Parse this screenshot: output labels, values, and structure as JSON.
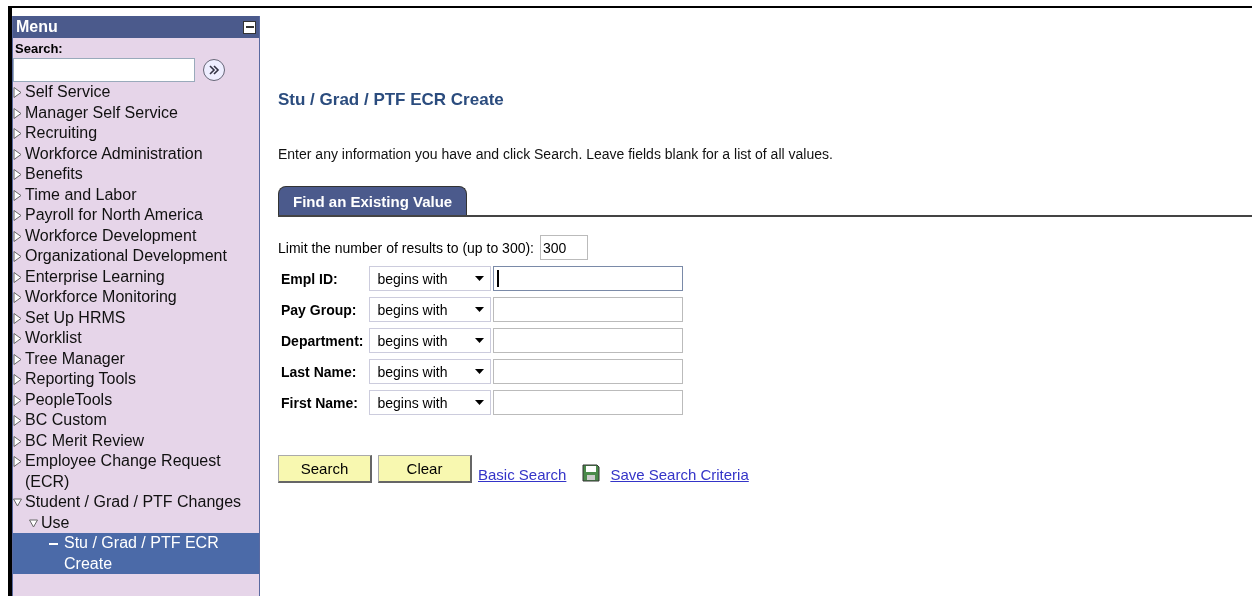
{
  "menu": {
    "title": "Menu",
    "search_label": "Search:",
    "items": [
      {
        "label": "Self Service",
        "expanded": false,
        "selected": false
      },
      {
        "label": "Manager Self Service",
        "expanded": false,
        "selected": false
      },
      {
        "label": "Recruiting",
        "expanded": false,
        "selected": false
      },
      {
        "label": "Workforce Administration",
        "expanded": false,
        "selected": false
      },
      {
        "label": "Benefits",
        "expanded": false,
        "selected": false
      },
      {
        "label": "Time and Labor",
        "expanded": false,
        "selected": false
      },
      {
        "label": "Payroll for North America",
        "expanded": false,
        "selected": false
      },
      {
        "label": "Workforce Development",
        "expanded": false,
        "selected": false
      },
      {
        "label": "Organizational Development",
        "expanded": false,
        "selected": false
      },
      {
        "label": "Enterprise Learning",
        "expanded": false,
        "selected": false
      },
      {
        "label": "Workforce Monitoring",
        "expanded": false,
        "selected": false
      },
      {
        "label": "Set Up HRMS",
        "expanded": false,
        "selected": false
      },
      {
        "label": "Worklist",
        "expanded": false,
        "selected": false
      },
      {
        "label": "Tree Manager",
        "expanded": false,
        "selected": false
      },
      {
        "label": "Reporting Tools",
        "expanded": false,
        "selected": false
      },
      {
        "label": "PeopleTools",
        "expanded": false,
        "selected": false
      },
      {
        "label": "BC Custom",
        "expanded": false,
        "selected": false
      },
      {
        "label": "BC Merit Review",
        "expanded": false,
        "selected": false
      },
      {
        "label": "Employee Change Request (ECR)",
        "expanded": false,
        "selected": false
      },
      {
        "label": "Student / Grad / PTF Changes",
        "expanded": true,
        "selected": false,
        "children": [
          {
            "label": "Use",
            "expanded": true,
            "selected": false,
            "children": [
              {
                "label": "Stu / Grad / PTF ECR Create",
                "kind": "page",
                "selected": true
              }
            ]
          }
        ]
      }
    ]
  },
  "page": {
    "title": "Stu / Grad / PTF ECR Create",
    "instructions": "Enter any information you have and click Search. Leave fields blank for a list of all values.",
    "tabs": [
      {
        "label": "Find an Existing Value",
        "selected": true
      }
    ],
    "limit": {
      "label": "Limit the number of results to (up to 300):",
      "value": "300"
    },
    "fields": [
      {
        "label": "Empl ID:",
        "operator": "begins with",
        "focused": true
      },
      {
        "label": "Pay Group:",
        "operator": "begins with",
        "focused": false
      },
      {
        "label": "Department:",
        "operator": "begins with",
        "focused": false
      },
      {
        "label": "Last Name:",
        "operator": "begins with",
        "focused": false
      },
      {
        "label": "First Name:",
        "operator": "begins with",
        "focused": false
      }
    ],
    "buttons": [
      "Search",
      "Clear"
    ],
    "links": [
      {
        "label": "Basic Search",
        "kind": "link"
      },
      {
        "label": "Save Search Criteria",
        "kind": "save"
      }
    ]
  }
}
